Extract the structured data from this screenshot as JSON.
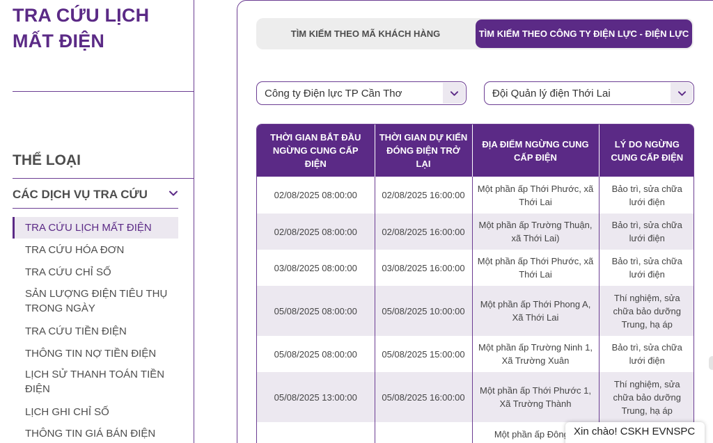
{
  "page_title": "TRA CỨU LỊCH MẤT ĐIỆN",
  "sidebar": {
    "category_heading": "THỂ LOẠI",
    "group_label": "CÁC DỊCH VỤ TRA CỨU",
    "items": [
      {
        "label": "TRA CỨU LỊCH MẤT ĐIỆN"
      },
      {
        "label": "TRA CỨU HÓA ĐƠN"
      },
      {
        "label": "TRA CỨU CHỈ SỐ"
      },
      {
        "label": "SẢN LƯỢNG ĐIỆN TIÊU THỤ TRONG NGÀY"
      },
      {
        "label": "TRA CỨU TIỀN ĐIỆN"
      },
      {
        "label": "THÔNG TIN NỢ TIỀN ĐIỆN"
      },
      {
        "label": "LỊCH SỬ THANH TOÁN TIỀN ĐIỆN"
      },
      {
        "label": "LỊCH GHI CHỈ SỐ"
      },
      {
        "label": "THÔNG TIN GIÁ BÁN ĐIỆN"
      }
    ]
  },
  "tabs": [
    {
      "label": "TÌM KIẾM THEO MÃ KHÁCH HÀNG",
      "active": false
    },
    {
      "label": "TÌM KIẾM THEO CÔNG TY ĐIỆN LỰC - ĐIỆN LỰC",
      "active": true
    }
  ],
  "filters": {
    "company": "Công ty Điện lực TP Cần Thơ",
    "unit": "Đội Quản lý điện Thới Lai"
  },
  "table": {
    "headers": [
      "THỜI GIAN BẮT ĐẦU NGỪNG CUNG CẤP ĐIỆN",
      "THỜI GIAN DỰ KIẾN ĐÓNG ĐIỆN TRỞ LẠI",
      "ĐỊA ĐIỂM NGỪNG CUNG CẤP ĐIỆN",
      "LÝ DO NGỪNG CUNG CẤP ĐIỆN"
    ],
    "rows": [
      [
        "02/08/2025 08:00:00",
        "02/08/2025 16:00:00",
        "Một phần ấp Thới Phước, xã Thới Lai",
        "Bảo trì, sửa chữa lưới điện"
      ],
      [
        "02/08/2025 08:00:00",
        "02/08/2025 16:00:00",
        "Một phần ấp Trường Thuận, xã Thới Lai)",
        "Bảo trì, sửa chữa lưới điện"
      ],
      [
        "03/08/2025 08:00:00",
        "03/08/2025 16:00:00",
        "Một phần ấp Thới Phước, xã Thới Lai",
        "Bảo trì, sửa chữa lưới điện"
      ],
      [
        "05/08/2025 08:00:00",
        "05/08/2025 10:00:00",
        "Một phần ấp Thới Phong A, Xã Thới Lai",
        "Thí nghiệm, sửa chữa bảo dưỡng Trung, hạ áp"
      ],
      [
        "05/08/2025 08:00:00",
        "05/08/2025 15:00:00",
        "Một phần ấp Trường Ninh 1, Xã Trường Xuân",
        "Bảo trì, sửa chữa lưới điện"
      ],
      [
        "05/08/2025 13:00:00",
        "05/08/2025 16:00:00",
        "Một phần ấp Thới Phước 1, Xã Trường Thành",
        "Thí nghiệm, sửa chữa bảo dưỡng Trung, hạ áp"
      ],
      [
        "",
        "",
        "Một phần ấp Đông T",
        ""
      ]
    ]
  },
  "chat": {
    "greeting": "Xin chào! CSKH EVNSPC"
  },
  "colors": {
    "brand": "#5b2a86",
    "row_alt": "#ece8f0"
  }
}
